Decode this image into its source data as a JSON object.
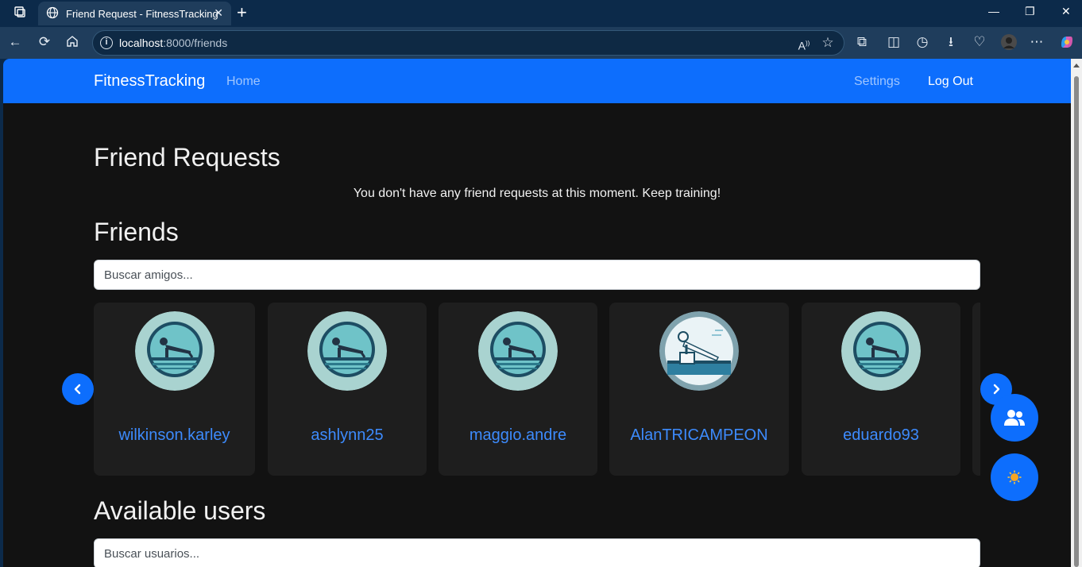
{
  "browser": {
    "tab_title": "Friend Request - FitnessTracking",
    "url_host": "localhost",
    "url_rest": ":8000/friends"
  },
  "navbar": {
    "brand": "FitnessTracking",
    "home": "Home",
    "settings": "Settings",
    "logout": "Log Out"
  },
  "friend_requests": {
    "title": "Friend Requests",
    "empty_message": "You don't have any friend requests at this moment. Keep training!"
  },
  "friends": {
    "title": "Friends",
    "search_placeholder": "Buscar amigos...",
    "items": [
      {
        "username": "wilkinson.karley",
        "avatar": "pushup-avatar-icon"
      },
      {
        "username": "ashlynn25",
        "avatar": "pushup-avatar-icon"
      },
      {
        "username": "maggio.andre",
        "avatar": "pushup-avatar-icon"
      },
      {
        "username": "AlanTRICAMPEON",
        "avatar": "box-pushup-avatar-icon"
      },
      {
        "username": "eduardo93",
        "avatar": "pushup-avatar-icon"
      }
    ]
  },
  "available_users": {
    "title": "Available users",
    "search_placeholder": "Buscar usuarios..."
  },
  "colors": {
    "primary": "#0d6efd",
    "background": "#121212",
    "card": "#1e1e1e",
    "link": "#3d8bfd"
  }
}
